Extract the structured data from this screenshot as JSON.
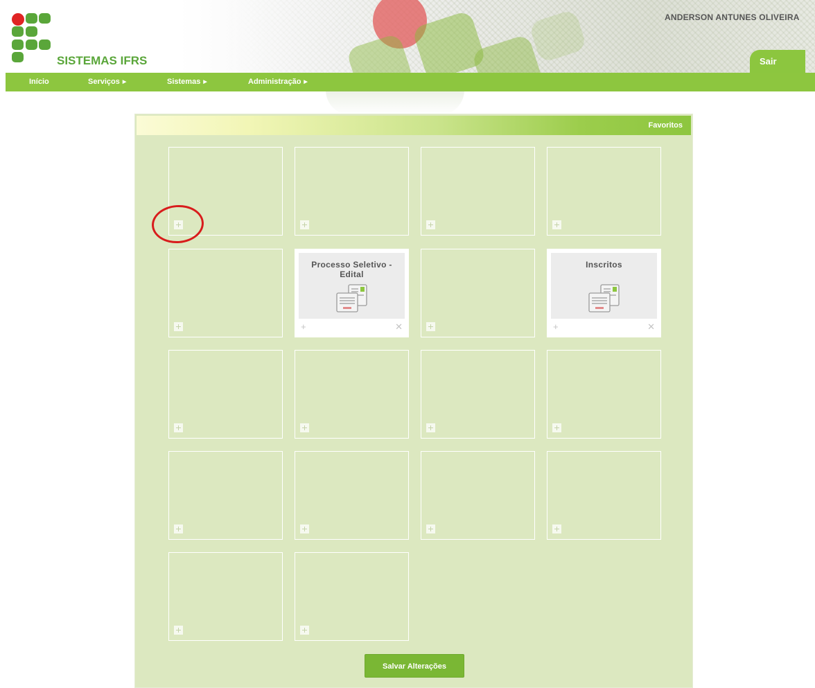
{
  "header": {
    "brand": "SISTEMAS IFRS",
    "username": "ANDERSON ANTUNES OLIVEIRA",
    "logout_label": "Sair"
  },
  "nav": {
    "items": [
      {
        "label": "Início",
        "has_submenu": false
      },
      {
        "label": "Serviços",
        "has_submenu": true
      },
      {
        "label": "Sistemas",
        "has_submenu": true
      },
      {
        "label": "Administração",
        "has_submenu": true
      }
    ]
  },
  "favorites": {
    "title": "Favoritos",
    "slots": [
      {
        "filled": false
      },
      {
        "filled": false
      },
      {
        "filled": false
      },
      {
        "filled": false
      },
      {
        "filled": false
      },
      {
        "filled": true,
        "label": "Processo Seletivo - Edital",
        "icon": "documents-icon"
      },
      {
        "filled": false
      },
      {
        "filled": true,
        "label": "Inscritos",
        "icon": "documents-icon"
      },
      {
        "filled": false
      },
      {
        "filled": false
      },
      {
        "filled": false
      },
      {
        "filled": false
      },
      {
        "filled": false
      },
      {
        "filled": false
      },
      {
        "filled": false
      },
      {
        "filled": false
      },
      {
        "filled": false
      },
      {
        "filled": false
      }
    ],
    "save_label": "Salvar Alterações"
  },
  "colors": {
    "brand_green": "#8dc63f",
    "panel_bg": "#dce8c0",
    "logo_red": "#e02424",
    "annotation_red": "#d81c1c"
  }
}
